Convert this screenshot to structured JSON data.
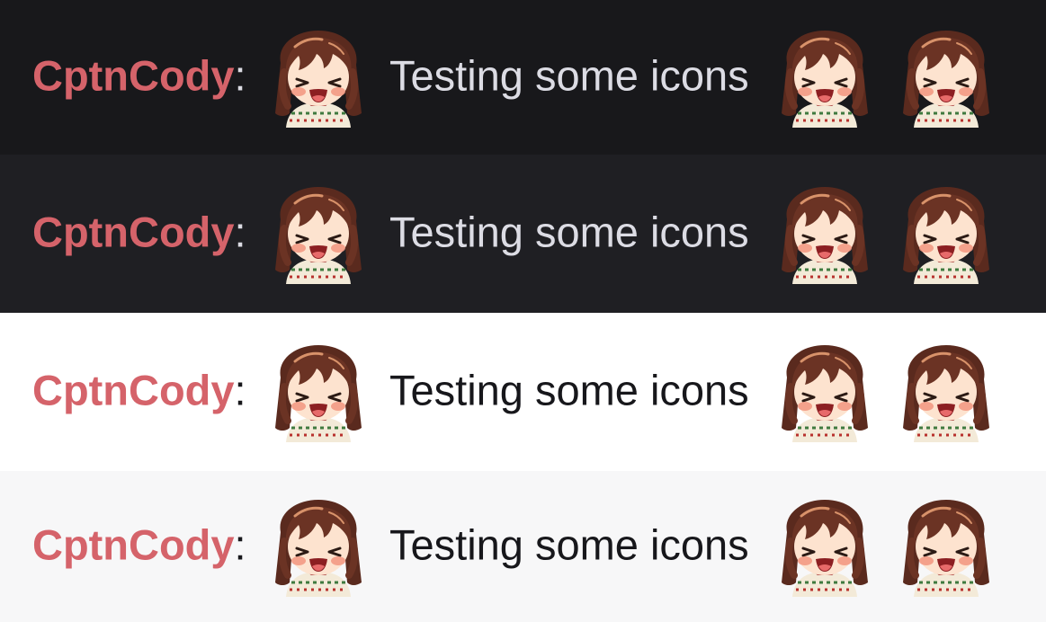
{
  "colors": {
    "username": "#d5636a",
    "dark_text": "#dcdce4",
    "light_text": "#17171b"
  },
  "rows": [
    {
      "theme": "dark",
      "background": "#18181b",
      "username": "CptnCody",
      "colon": ":",
      "message": "Testing some icons"
    },
    {
      "theme": "dark-alt",
      "background": "#1f1f23",
      "username": "CptnCody",
      "colon": ":",
      "message": "Testing some icons"
    },
    {
      "theme": "light",
      "background": "#ffffff",
      "username": "CptnCody",
      "colon": ":",
      "message": "Testing some icons"
    },
    {
      "theme": "light-alt",
      "background": "#f7f7f8",
      "username": "CptnCody",
      "colon": ":",
      "message": "Testing some icons"
    }
  ],
  "emote": {
    "icon": "chibi-girl-laughing-emote"
  }
}
